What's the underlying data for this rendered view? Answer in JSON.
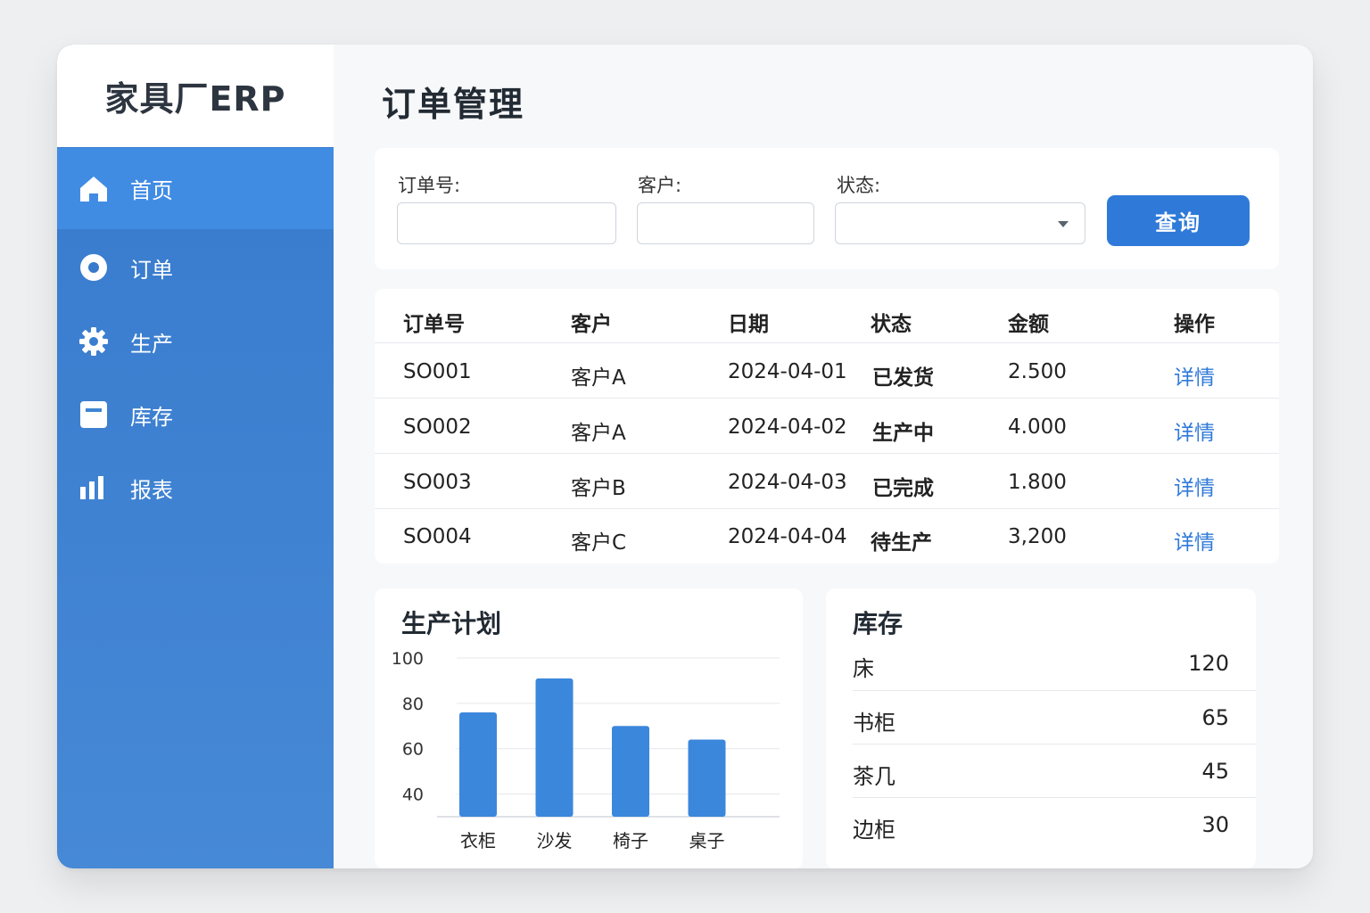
{
  "brand": "家具厂ERP",
  "sidebar": {
    "items": [
      {
        "label": "首页",
        "icon": "home-icon"
      },
      {
        "label": "订单",
        "icon": "circle-dot-icon"
      },
      {
        "label": "生产",
        "icon": "gear-icon"
      },
      {
        "label": "库存",
        "icon": "box-icon"
      },
      {
        "label": "报表",
        "icon": "bar-chart-icon"
      }
    ],
    "active_index": 0
  },
  "page_title": "订单管理",
  "filters": {
    "order_no_label": "订单号:",
    "customer_label": "客户:",
    "status_label": "状态:",
    "order_no_value": "",
    "customer_value": "",
    "status_value": "",
    "query_button": "查询"
  },
  "table": {
    "headers": [
      "订单号",
      "客户",
      "日期",
      "状态",
      "金额",
      "操作"
    ],
    "rows": [
      {
        "order_no": "SO001",
        "customer": "客户A",
        "date": "2024-04-01",
        "status": "已发货",
        "amount": "2.500",
        "action": "详情"
      },
      {
        "order_no": "SO002",
        "customer": "客户A",
        "date": "2024-04-02",
        "status": "生产中",
        "amount": "4.000",
        "action": "详情"
      },
      {
        "order_no": "SO003",
        "customer": "客户B",
        "date": "2024-04-03",
        "status": "已完成",
        "amount": "1.800",
        "action": "详情"
      },
      {
        "order_no": "SO004",
        "customer": "客户C",
        "date": "2024-04-04",
        "status": "待生产",
        "amount": "3,200",
        "action": "详情"
      }
    ]
  },
  "production": {
    "title": "生产计划"
  },
  "chart_data": {
    "type": "bar",
    "title": "生产计划",
    "categories": [
      "衣柜",
      "沙发",
      "椅子",
      "桌子"
    ],
    "values": [
      76,
      91,
      70,
      64
    ],
    "yticks": [
      40,
      60,
      80,
      100
    ],
    "ylim": [
      30,
      100
    ],
    "xlabel": "",
    "ylabel": "",
    "grid": true,
    "color": "#3b87dc"
  },
  "inventory": {
    "title": "库存",
    "items": [
      {
        "name": "床",
        "qty": "120"
      },
      {
        "name": "书柜",
        "qty": "65"
      },
      {
        "name": "茶几",
        "qty": "45"
      },
      {
        "name": "边柜",
        "qty": "30"
      }
    ]
  },
  "colors": {
    "accent": "#2f7ad8",
    "sidebar": "#3779cc",
    "sidebar_active": "#418ce3"
  }
}
